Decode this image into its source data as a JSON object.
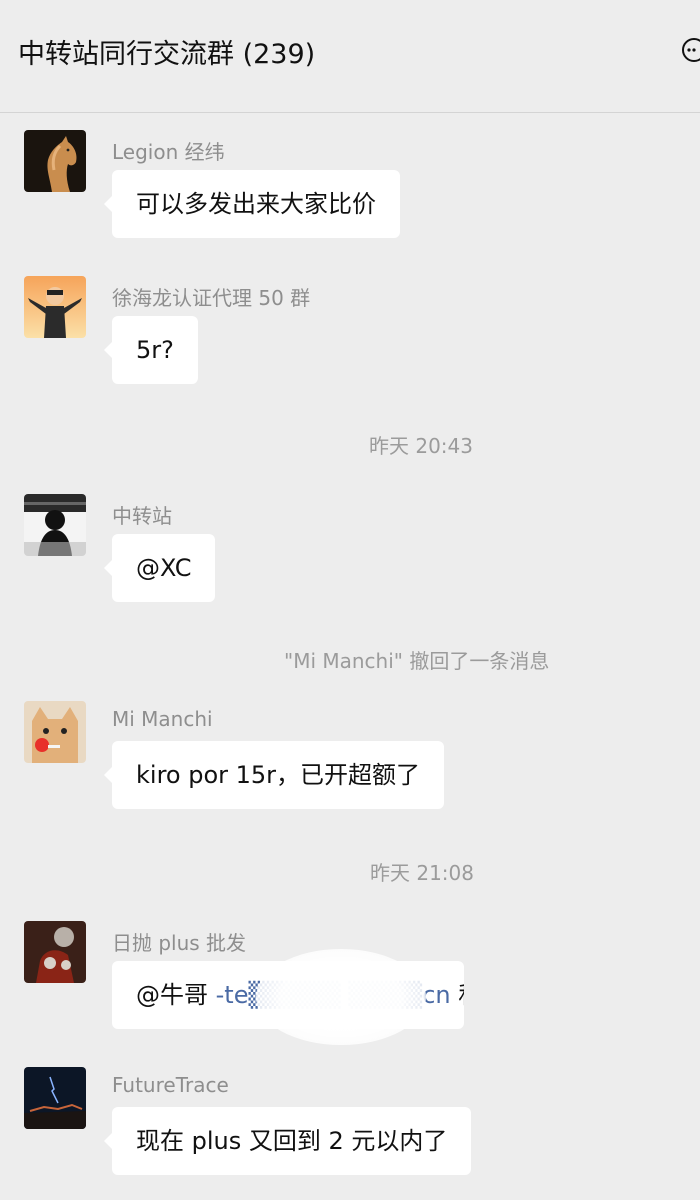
{
  "header": {
    "title": "中转站同行交流群 (239)",
    "icon": "chat-bubble-icon"
  },
  "messages": [
    {
      "sender": "Legion 经纬",
      "text": "可以多发出来大家比价",
      "avatar": "horse"
    },
    {
      "sender": "徐海龙认证代理 50 群",
      "text": "5r?",
      "avatar": "cartoon-man"
    },
    {
      "sender": "中转站",
      "text": "@XC",
      "avatar": "dark-figure"
    },
    {
      "sender": "Mi Manchi",
      "text": "kiro por 15r，已开超额了",
      "avatar": "cat-lollipop"
    },
    {
      "sender": "日抛 plus 批发",
      "text_prefix": "@牛哥 ",
      "text_link": "-te▒▒▒▒▒ ▒▒▒▒cn",
      "text_suffix": " 私",
      "avatar": "figure-red"
    },
    {
      "sender": "FutureTrace",
      "text": "现在 plus 又回到 2 元以内了",
      "avatar": "night-sky"
    }
  ],
  "system": {
    "time1": "昨天 20:43",
    "recall": "\"Mi Manchi\" 撤回了一条消息",
    "time2": "昨天 21:08"
  },
  "colors": {
    "background": "#ededed",
    "bubble": "#ffffff",
    "sender": "#8e8e8e",
    "link": "#4a6aa4"
  }
}
